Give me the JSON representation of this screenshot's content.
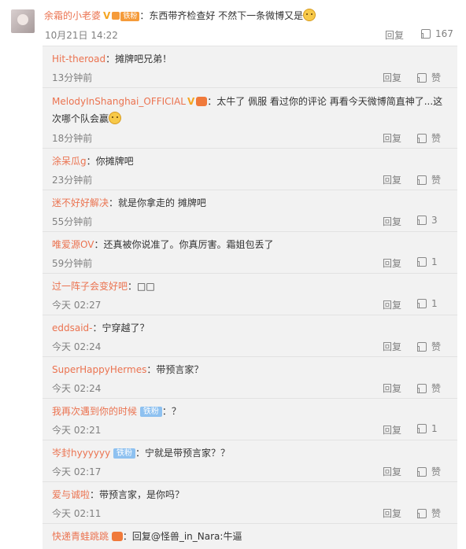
{
  "main_comment": {
    "username": "余霜的小老婆",
    "verified_badge": "V",
    "fan_badge": "铁粉",
    "text": "：东西带齐检查好 不然下一条微博又是",
    "time": "10月21日 14:22",
    "reply_label": "回复",
    "likes": "167"
  },
  "replies": [
    {
      "username": "Hit-theroad",
      "text": "：摊牌吧兄弟！",
      "time": "13分钟前",
      "reply_label": "回复",
      "like_label": "赞"
    },
    {
      "username": "MelodyInShanghai_OFFICIAL",
      "verified": "V",
      "text": "：太牛了 佩服 看过你的评论 再看今天微博简直神了...这次哪个队会赢",
      "time": "18分钟前",
      "reply_label": "回复",
      "like_label": "赞"
    },
    {
      "username": "涂呆瓜g",
      "text": "：你摊牌吧",
      "time": "23分钟前",
      "reply_label": "回复",
      "like_label": "赞"
    },
    {
      "username": "迷不好好解决",
      "text": "：就是你拿走的 摊牌吧",
      "time": "55分钟前",
      "reply_label": "回复",
      "like_label": "3"
    },
    {
      "username": "唯爱源OV",
      "text": "：还真被你说准了。你真厉害。霜姐包丢了",
      "time": "59分钟前",
      "reply_label": "回复",
      "like_label": "1"
    },
    {
      "username": "过一阵子会变好吧",
      "text": "：□□",
      "time": "今天 02:27",
      "reply_label": "回复",
      "like_label": "1"
    },
    {
      "username": "eddsaid-",
      "text": "：宁穿越了？",
      "time": "今天 02:24",
      "reply_label": "回复",
      "like_label": "赞"
    },
    {
      "username": "SuperHappyHermes",
      "text": "：带预言家？",
      "time": "今天 02:24",
      "reply_label": "回复",
      "like_label": "赞"
    },
    {
      "username": "我再次遇到你的时候",
      "fan_badge": "铁粉",
      "text": "：？",
      "time": "今天 02:21",
      "reply_label": "回复",
      "like_label": "1"
    },
    {
      "username": "岑封hyyyyyy",
      "fan_badge": "铁粉",
      "text": "：宁就是带预言家？？",
      "time": "今天 02:17",
      "reply_label": "回复",
      "like_label": "赞"
    },
    {
      "username": "爱与诚啦",
      "text": "：带预言家，是你吗？",
      "time": "今天 02:11",
      "reply_label": "回复",
      "like_label": "赞"
    },
    {
      "username": "快递青蛙跳跳",
      "text": "：回复@怪兽_in_Nara:牛逼",
      "time": "",
      "reply_label": "",
      "like_label": ""
    }
  ]
}
